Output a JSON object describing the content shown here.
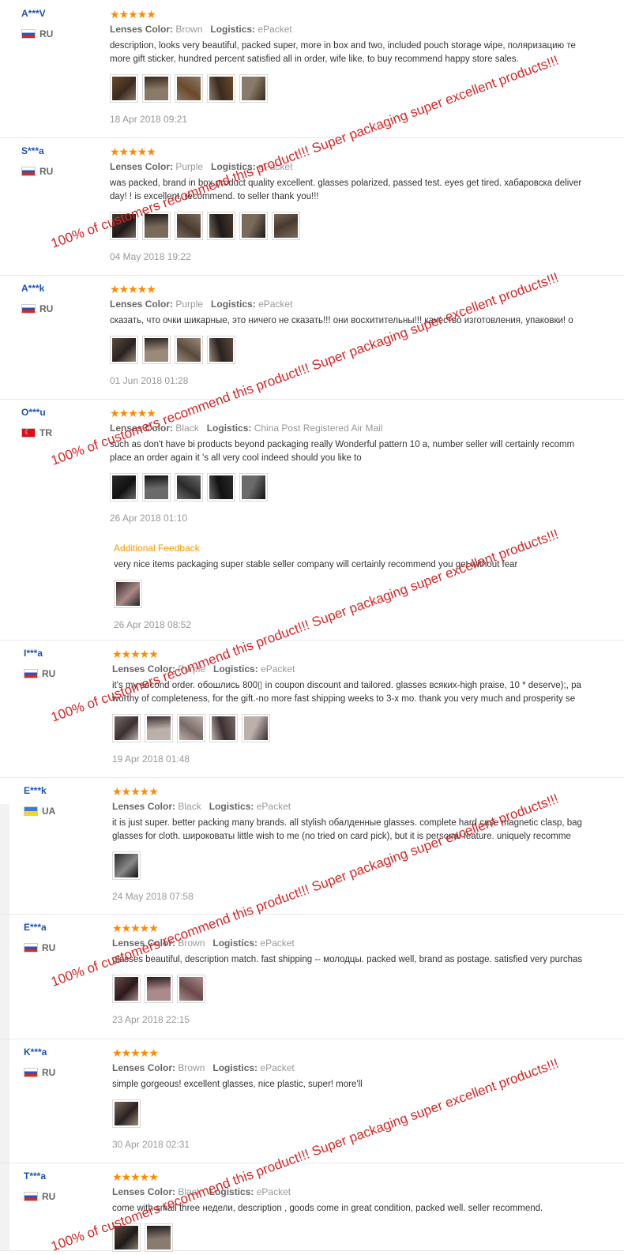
{
  "labels": {
    "lenses_color": "Lenses Color:",
    "logistics": "Logistics:",
    "additional_feedback": "Additional Feedback"
  },
  "watermark": {
    "line1": "100% of customers recommend this product!!! Super packaging super excellent products!!!"
  },
  "reviews": [
    {
      "user": "A***V",
      "country": "RU",
      "stars": "★★★★★",
      "lenses_color": "Brown",
      "logistics": "ePacket",
      "text": [
        "description, looks very beautiful, packed super, more in box and two, included pouch storage wipe, поляризацию те",
        "more gift sticker, hundred percent satisfied all in order, wife like, to buy recommend happy store sales."
      ],
      "photo_count": 5,
      "date": "18 Apr 2018 09:21"
    },
    {
      "user": "S***a",
      "country": "RU",
      "stars": "★★★★★",
      "lenses_color": "Purple",
      "logistics": "ePacket",
      "text": [
        "was packed, brand in box product quality excellent. glasses polarized, passed test. eyes get tired. хабаровска deliver",
        "day! ! is excellent. recommend. to seller thank you!!!"
      ],
      "photo_count": 6,
      "date": "04 May 2018 19:22"
    },
    {
      "user": "A***k",
      "country": "RU",
      "stars": "★★★★★",
      "lenses_color": "Purple",
      "logistics": "ePacket",
      "text": [
        "сказать, что очки шикарные, это ничего не сказать!!! они восхитительны!!! качество изготовления, упаковки! о"
      ],
      "photo_count": 4,
      "date": "01 Jun 2018 01:28"
    },
    {
      "user": "O***u",
      "country": "TR",
      "stars": "★★★★★",
      "lenses_color": "Black",
      "logistics": "China Post Registered Air Mail",
      "text": [
        "such as don't have bi products beyond packaging really Wonderful pattern 10 a, number seller will certainly recomm",
        "place an order again it 's all very cool indeed should you like to"
      ],
      "photo_count": 5,
      "date": "26 Apr 2018 01:10",
      "additional": {
        "text": "very nice items packaging super stable seller company will certainly recommend you get without fear",
        "photo_count": 1,
        "date": "26 Apr 2018 08:52"
      }
    },
    {
      "user": "I***a",
      "country": "RU",
      "stars": "★★★★★",
      "lenses_color": "Purple",
      "logistics": "ePacket",
      "text": [
        "it's my second order. обошлись 800▯ in coupon discount and tailored. glasses всяких-high praise, 10 * deserve);, pa",
        "worthy of completeness, for the gift.-no more fast shipping weeks to 3-x mo. thank you very much and prosperity se"
      ],
      "photo_count": 5,
      "date": "19 Apr 2018 01:48"
    },
    {
      "user": "E***k",
      "country": "UA",
      "stars": "★★★★★",
      "lenses_color": "Black",
      "logistics": "ePacket",
      "text": [
        "it is just super. better packing many brands. all stylish обалденные glasses. complete hard case magnetic clasp, bag",
        "glasses for cloth. широковаты little wish to me (no tried on card pick), but it is personal feature. uniquely recomme"
      ],
      "photo_count": 1,
      "date": "24 May 2018 07:58"
    },
    {
      "user": "E***a",
      "country": "RU",
      "stars": "★★★★★",
      "lenses_color": "Brown",
      "logistics": "ePacket",
      "text": [
        "glasses beautiful, description match. fast shipping -- молодцы. packed well, brand as postage. satisfied very purchas"
      ],
      "photo_count": 3,
      "date": "23 Apr 2018 22:15"
    },
    {
      "user": "K***a",
      "country": "RU",
      "stars": "★★★★★",
      "lenses_color": "Brown",
      "logistics": "ePacket",
      "text": [
        "simple gorgeous! excellent glasses, nice plastic, super! more'll"
      ],
      "photo_count": 1,
      "date": "30 Apr 2018 02:31"
    },
    {
      "user": "T***a",
      "country": "RU",
      "stars": "★★★★★",
      "lenses_color": "Black",
      "logistics": "ePacket",
      "text": [
        "come with small three недели, description , goods come in great condition, packed well. seller recommend."
      ],
      "photo_count": 2,
      "date": ""
    }
  ]
}
